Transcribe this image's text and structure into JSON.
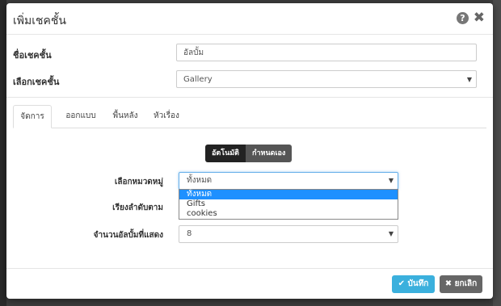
{
  "modal": {
    "title": "เพิ่มเชคชั้น",
    "help_icon": "?",
    "close_icon": "✖"
  },
  "form": {
    "name_label": "ชื่อเชคชั้น",
    "name_value": "อัลบั้ม",
    "type_label": "เลือกเชคชั้น",
    "type_value": "Gallery"
  },
  "tabs": [
    "จัดการ",
    "ออกแบบ",
    "พื้นหลัง",
    "หัวเรื่อง"
  ],
  "mode_toggle": {
    "auto": "อัตโนมัติ",
    "manual": "กำหนดเอง"
  },
  "category": {
    "label": "เลือกหมวดหมู่",
    "value": "ทั้งหมด",
    "options": [
      "ทั้งหมด",
      "Gifts",
      "cookies"
    ]
  },
  "sort": {
    "label": "เรียงลำดับตาม"
  },
  "count": {
    "label": "จำนวนอัลบั้มที่แสดง",
    "value": "8"
  },
  "footer": {
    "save_label": "บันทึก",
    "cancel_label": "ยกเลิก",
    "check_icon": "✔",
    "x_icon": "✖"
  }
}
